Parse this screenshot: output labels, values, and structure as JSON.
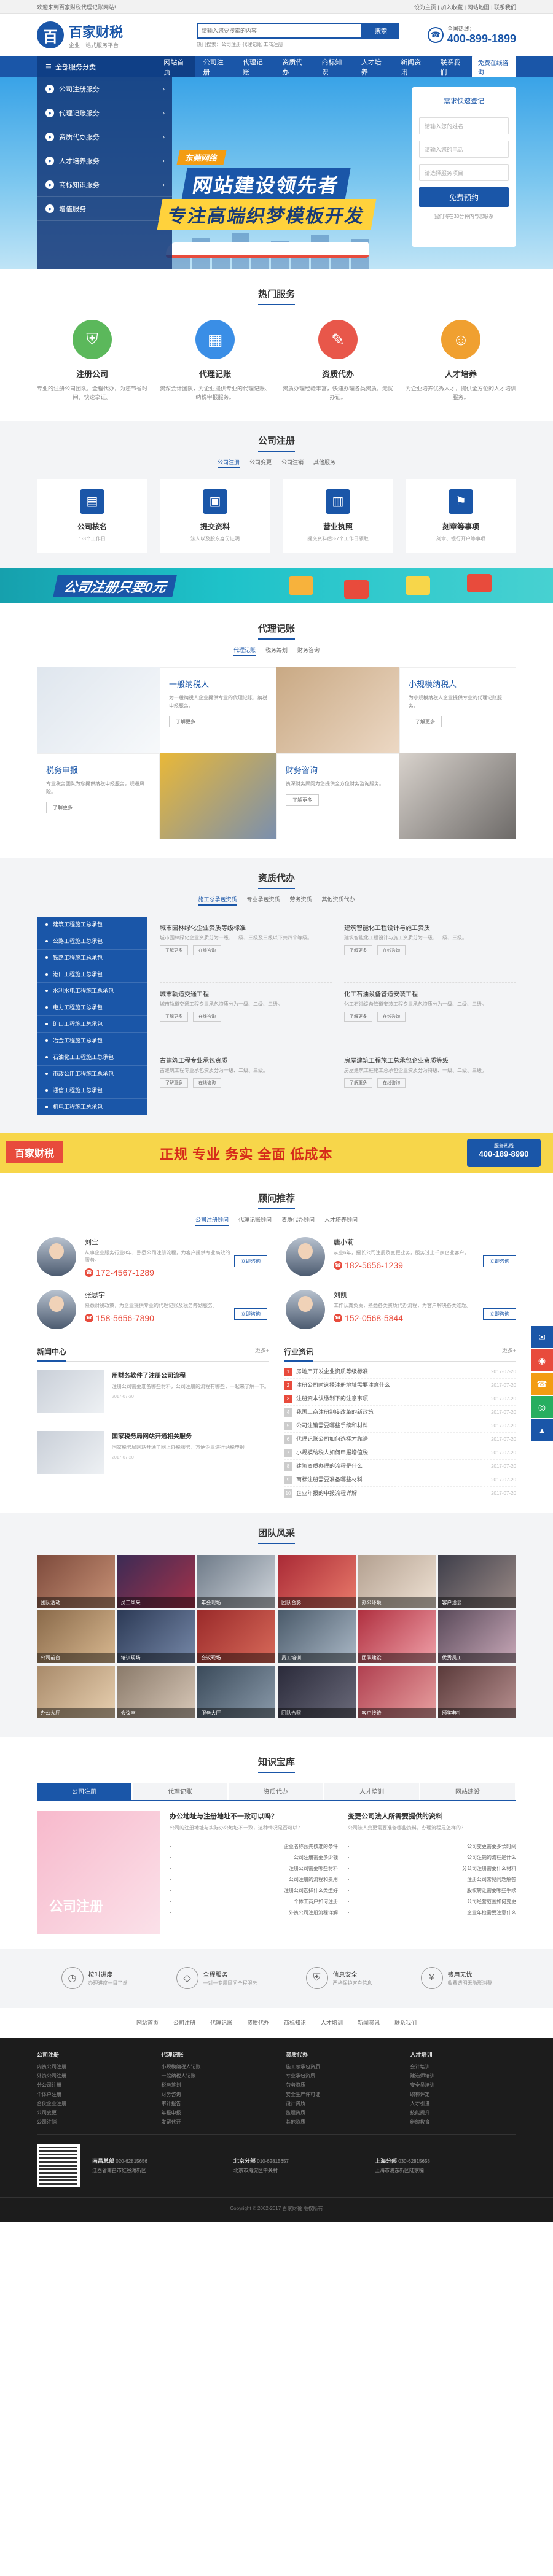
{
  "topbar": {
    "welcome": "欢迎来到百家财税代理记账网站!",
    "links": [
      "设为主页",
      "加入收藏",
      "网站地图",
      "联系我们"
    ]
  },
  "header": {
    "logo_mark": "百",
    "logo_title": "百家财税",
    "logo_sub": "企业一站式服务平台",
    "search_placeholder": "请输入您要搜索的内容",
    "search_button": "搜索",
    "hot_keywords": "热门搜索：公司注册 代理记账 工商注册",
    "hotline_label": "全国热线：",
    "hotline": "400-899-1899"
  },
  "nav": {
    "all_categories": "全部服务分类",
    "items": [
      "网站首页",
      "公司注册",
      "代理记账",
      "资质代办",
      "商标知识",
      "人才培养",
      "新闻资讯",
      "联系我们"
    ],
    "online": "免费在线咨询"
  },
  "banner": {
    "side_items": [
      "公司注册服务",
      "代理记账服务",
      "资质代办服务",
      "人才培养服务",
      "商标知识服务",
      "增值服务"
    ],
    "tag": "东莞网络",
    "headline1": "网站建设领先者",
    "headline2": "专注高端织梦模板开发",
    "form": {
      "title": "需求快速登记",
      "name_placeholder": "请输入您的姓名",
      "phone_placeholder": "请输入您的电话",
      "service_placeholder": "请选择服务项目",
      "submit": "免费预约",
      "tip": "我们将在30分钟内与您联系"
    }
  },
  "hot_service": {
    "title": "热门服务",
    "cards": [
      {
        "icon": "shield-icon",
        "title": "注册公司",
        "desc": "专业的注册公司团队，全程代办，为您节省时间，快速拿证。"
      },
      {
        "icon": "calendar-icon",
        "title": "代理记账",
        "desc": "资深会计团队，为企业提供专业的代理记账、纳税申报服务。"
      },
      {
        "icon": "certificate-icon",
        "title": "资质代办",
        "desc": "资质办理经验丰富，快速办理各类资质，无忧办证。"
      },
      {
        "icon": "person-icon",
        "title": "人才培养",
        "desc": "为企业培养优秀人才，提供全方位的人才培训服务。"
      }
    ]
  },
  "company_reg": {
    "title": "公司注册",
    "tabs": [
      "公司注册",
      "公司变更",
      "公司注销",
      "其他服务"
    ],
    "cards": [
      {
        "title": "公司核名",
        "desc": "1-3个工作日"
      },
      {
        "title": "提交资料",
        "desc": "法人以及股东身份证明"
      },
      {
        "title": "营业执照",
        "desc": "提交资料后3-7个工作日领取"
      },
      {
        "title": "刻章等事项",
        "desc": "刻章、银行开户等事项"
      }
    ]
  },
  "promo1": {
    "text": "公司注册只要0元"
  },
  "agency": {
    "title": "代理记账",
    "tabs": [
      "代理记账",
      "税务筹划",
      "财务咨询"
    ],
    "items": [
      {
        "title": "一般纳税人",
        "desc": "为一般纳税人企业提供专业的代理记账、纳税申报服务。",
        "btn": "了解更多"
      },
      {
        "title": "小规模纳税人",
        "desc": "为小规模纳税人企业提供专业的代理记账服务。",
        "btn": "了解更多"
      },
      {
        "title": "税务申报",
        "desc": "专业税务团队为您提供纳税申报服务，规避风险。",
        "btn": "了解更多"
      },
      {
        "title": "财务咨询",
        "desc": "资深财务顾问为您提供全方位财务咨询服务。",
        "btn": "了解更多"
      }
    ]
  },
  "qualification": {
    "title": "资质代办",
    "tabs": [
      "施工总承包资质",
      "专业承包资质",
      "劳务资质",
      "其他资质代办"
    ],
    "side": [
      "建筑工程施工总承包",
      "公路工程施工总承包",
      "铁路工程施工总承包",
      "港口工程施工总承包",
      "水利水电工程施工总承包",
      "电力工程施工总承包",
      "矿山工程施工总承包",
      "冶金工程施工总承包",
      "石油化工工程施工总承包",
      "市政公用工程施工总承包",
      "通信工程施工总承包",
      "机电工程施工总承包"
    ],
    "items": [
      {
        "title": "城市园林绿化企业资质等级标准",
        "desc": "城市园林绿化企业资质分为一级、二级、三级及三级以下共四个等级。",
        "b1": "了解更多",
        "b2": "在线咨询"
      },
      {
        "title": "建筑智能化工程设计与施工资质",
        "desc": "建筑智能化工程设计与施工资质分为一级、二级、三级。",
        "b1": "了解更多",
        "b2": "在线咨询"
      },
      {
        "title": "城市轨道交通工程",
        "desc": "城市轨道交通工程专业承包资质分为一级、二级、三级。",
        "b1": "了解更多",
        "b2": "在线咨询"
      },
      {
        "title": "化工石油设备管道安装工程",
        "desc": "化工石油设备管道安装工程专业承包资质分为一级、二级、三级。",
        "b1": "了解更多",
        "b2": "在线咨询"
      },
      {
        "title": "古建筑工程专业承包资质",
        "desc": "古建筑工程专业承包资质分为一级、二级、三级。",
        "b1": "了解更多",
        "b2": "在线咨询"
      },
      {
        "title": "房屋建筑工程施工总承包企业资质等级",
        "desc": "房屋建筑工程施工总承包企业资质分为特级、一级、二级、三级。",
        "b1": "了解更多",
        "b2": "在线咨询"
      }
    ]
  },
  "promo2": {
    "logo": "百家财税",
    "slogan": "正规 专业 务实 全面 低成本",
    "phone_label": "服务热线",
    "phone": "400-189-8990"
  },
  "advisors": {
    "title": "顾问推荐",
    "tabs": [
      "公司注册顾问",
      "代理记账顾问",
      "资质代办顾问",
      "人才培养顾问"
    ],
    "list": [
      {
        "name": "刘宝",
        "desc": "从事企业服务行业8年，熟悉公司注册流程，为客户提供专业高效的服务。",
        "phone": "172-4567-1289",
        "btn": "立即咨询"
      },
      {
        "name": "唐小莉",
        "desc": "从业6年，擅长公司注册及变更业务，服务过上千家企业客户。",
        "phone": "182-5656-1239",
        "btn": "立即咨询"
      },
      {
        "name": "张思宇",
        "desc": "熟悉财税政策，为企业提供专业的代理记账及税务筹划服务。",
        "phone": "158-5656-7890",
        "btn": "立即咨询"
      },
      {
        "name": "刘凯",
        "desc": "工作认真负责，熟悉各类资质代办流程，为客户解决各类难题。",
        "phone": "152-0568-5844",
        "btn": "立即咨询"
      }
    ]
  },
  "news": {
    "center_title": "新闻中心",
    "more": "更多+",
    "center": [
      {
        "title": "用财务软件了注册公司流程",
        "desc": "注册公司需要准备哪些材料，公司注册的流程有哪些，一起来了解一下。",
        "meta": "2017-07-20"
      },
      {
        "title": "国家税务局网站开通相关服务",
        "desc": "国家税务局网站开通了网上办税服务，方便企业进行纳税申报。",
        "meta": "2017-07-20"
      }
    ],
    "industry_title": "行业资讯",
    "industry": [
      {
        "t": "房地产开发企业资质等级标准",
        "d": "2017-07-20"
      },
      {
        "t": "注册公司时选择注册地址需要注意什么",
        "d": "2017-07-20"
      },
      {
        "t": "注册资本认缴制下的注意事项",
        "d": "2017-07-20"
      },
      {
        "t": "我国工商注册制度改革的新政策",
        "d": "2017-07-20"
      },
      {
        "t": "公司注销需要哪些手续和材料",
        "d": "2017-07-20"
      },
      {
        "t": "代理记账公司如何选择才靠谱",
        "d": "2017-07-20"
      },
      {
        "t": "小规模纳税人如何申报增值税",
        "d": "2017-07-20"
      },
      {
        "t": "建筑资质办理的流程是什么",
        "d": "2017-07-20"
      },
      {
        "t": "商标注册需要准备哪些材料",
        "d": "2017-07-20"
      },
      {
        "t": "企业年报的申报流程详解",
        "d": "2017-07-20"
      }
    ]
  },
  "team": {
    "title": "团队风采",
    "photos": [
      "团队活动",
      "员工风采",
      "年会现场",
      "团队合影",
      "办公环境",
      "客户洽谈",
      "公司前台",
      "培训现场",
      "会议现场",
      "员工培训",
      "团队建设",
      "优秀员工",
      "办公大厅",
      "会议室",
      "服务大厅",
      "团队合照",
      "客户接待",
      "颁奖典礼"
    ]
  },
  "knowledge": {
    "title": "知识宝库",
    "tabs": [
      "公司注册",
      "代理记账",
      "资质代办",
      "人才培训",
      "网站建设"
    ],
    "img_text": "公司注册",
    "col1": {
      "title": "办公地址与注册地址不一致可以吗？",
      "sub": "公司的注册地址与实际办公地址不一致，这种情况是否可以？",
      "items": [
        "企业名称预先核准的条件",
        "公司注册需要多少钱",
        "注册公司需要哪些材料",
        "公司注册的流程和费用",
        "注册公司选择什么类型好",
        "个体工商户如何注册",
        "外资公司注册流程详解"
      ]
    },
    "col2": {
      "title": "变更公司法人所需要提供的资料",
      "sub": "公司法人变更需要准备哪些资料，办理流程是怎样的？",
      "items": [
        "公司变更需要多长时间",
        "公司注销的流程是什么",
        "分公司注册需要什么材料",
        "注册公司常见问题解答",
        "股权转让需要哪些手续",
        "公司经营范围如何变更",
        "企业年检需要注意什么"
      ]
    }
  },
  "service_bar": [
    {
      "icon": "clock-icon",
      "title": "按时进度",
      "desc": "办理进度一目了然"
    },
    {
      "icon": "diamond-icon",
      "title": "全程服务",
      "desc": "一对一专属顾问全程服务"
    },
    {
      "icon": "shield-icon",
      "title": "信息安全",
      "desc": "严格保护客户信息"
    },
    {
      "icon": "money-icon",
      "title": "费用无忧",
      "desc": "收费透明无隐形消费"
    }
  ],
  "footer_nav": [
    "网站首页",
    "公司注册",
    "代理记账",
    "资质代办",
    "商标知识",
    "人才培训",
    "新闻资讯",
    "联系我们"
  ],
  "footer_cols": [
    {
      "title": "公司注册",
      "items": [
        "内资公司注册",
        "外资公司注册",
        "分公司注册",
        "个体户注册",
        "合伙企业注册",
        "公司变更",
        "公司注销"
      ]
    },
    {
      "title": "代理记账",
      "items": [
        "小规模纳税人记账",
        "一般纳税人记账",
        "税务筹划",
        "财务咨询",
        "审计报告",
        "年报申报",
        "发票代开"
      ]
    },
    {
      "title": "资质代办",
      "items": [
        "施工总承包资质",
        "专业承包资质",
        "劳务资质",
        "安全生产许可证",
        "设计资质",
        "监理资质",
        "其他资质"
      ]
    },
    {
      "title": "人才培训",
      "items": [
        "会计培训",
        "建造师培训",
        "安全员培训",
        "职称评定",
        "人才引进",
        "技能提升",
        "继续教育"
      ]
    }
  ],
  "contact": [
    {
      "city": "南昌总部",
      "phone": "020-62815656",
      "addr": "江西省南昌市红谷滩新区"
    },
    {
      "city": "北京分部",
      "phone": "010-62815657",
      "addr": "北京市海淀区中关村"
    },
    {
      "city": "上海分部",
      "phone": "030-62815658",
      "addr": "上海市浦东新区陆家嘴"
    }
  ],
  "copyright": "Copyright © 2002-2017 百家财税 版权所有",
  "colors": {
    "primary": "#1a56a8",
    "accent": "#e84b3c",
    "yellow": "#f7d64a"
  }
}
